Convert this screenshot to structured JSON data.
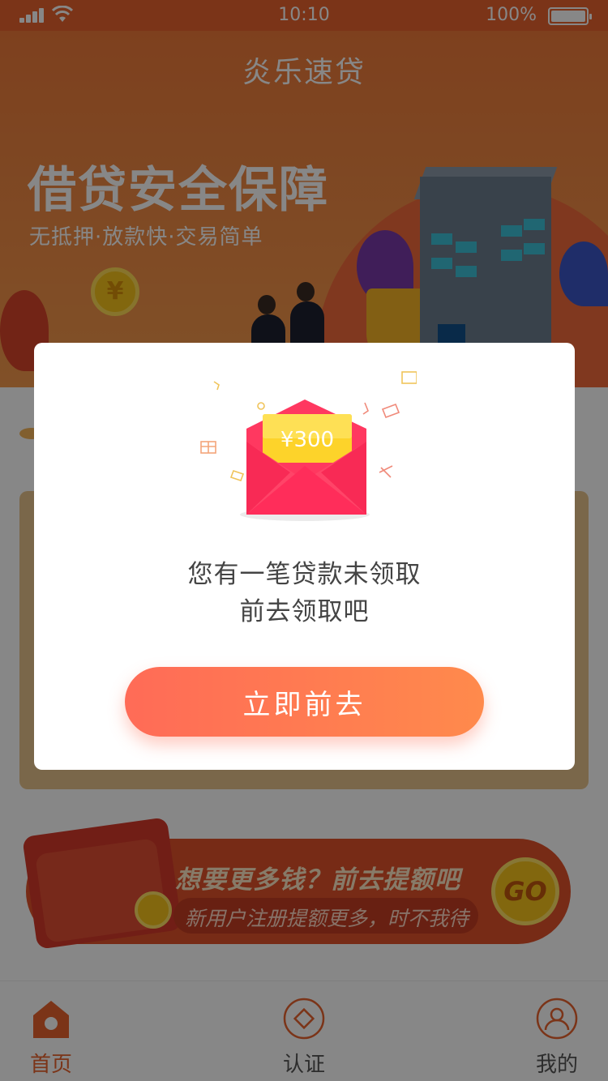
{
  "status_bar": {
    "time": "10:10",
    "battery": "100%"
  },
  "app": {
    "title": "炎乐速贷"
  },
  "hero": {
    "headline": "借贷安全保障",
    "subheadline": "无抵押·放款快·交易简单",
    "coin_symbol": "¥"
  },
  "promo": {
    "title": "想要更多钱？前去提额吧",
    "subtitle": "新用户注册提额更多，时不我待",
    "go_label": "GO"
  },
  "tabs": [
    {
      "label": "首页",
      "icon": "home-icon",
      "active": true
    },
    {
      "label": "认证",
      "icon": "verify-icon",
      "active": false
    },
    {
      "label": "我的",
      "icon": "profile-icon",
      "active": false
    }
  ],
  "modal": {
    "envelope_amount": "¥300",
    "message_line1": "您有一笔贷款未领取",
    "message_line2": "前去领取吧",
    "cta_label": "立即前去"
  },
  "colors": {
    "brand_orange": "#e9632e",
    "envelope_red": "#ff2d5a",
    "ticket_yellow": "#fdd32a",
    "cta_start": "#ff6b57",
    "cta_end": "#ff8a4c"
  }
}
